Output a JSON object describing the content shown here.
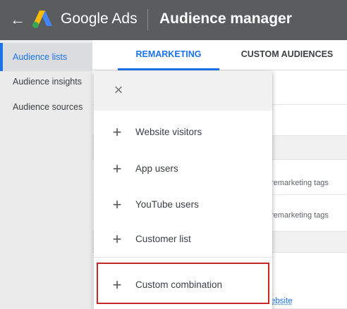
{
  "header": {
    "back_icon": "arrow-left-icon",
    "brand": "Google Ads",
    "title": "Audience manager",
    "logo_colors": [
      "#fbbc04",
      "#4285f4",
      "#34a853"
    ]
  },
  "sidebar": {
    "items": [
      {
        "label": "Audience lists",
        "active": true
      },
      {
        "label": "Audience insights",
        "active": false
      },
      {
        "label": "Audience sources",
        "active": false
      }
    ]
  },
  "tabs": [
    {
      "label": "REMARKETING",
      "active": true
    },
    {
      "label": "CUSTOM AUDIENCES",
      "active": false
    }
  ],
  "background": {
    "tag_text_1": "remarketing tags",
    "tag_text_2": "remarketing tags",
    "link_text": "ebsite"
  },
  "menu": {
    "close_icon": "close-icon",
    "items": [
      {
        "label": "Website visitors",
        "icon": "plus-icon"
      },
      {
        "label": "App users",
        "icon": "plus-icon"
      },
      {
        "label": "YouTube users",
        "icon": "plus-icon"
      },
      {
        "label": "Customer list",
        "icon": "plus-icon"
      },
      {
        "label": "Custom combination",
        "icon": "plus-icon",
        "highlighted": true
      }
    ]
  },
  "colors": {
    "header_bg": "#5a5c5e",
    "accent": "#1a73e8",
    "highlight_border": "#c62828"
  }
}
